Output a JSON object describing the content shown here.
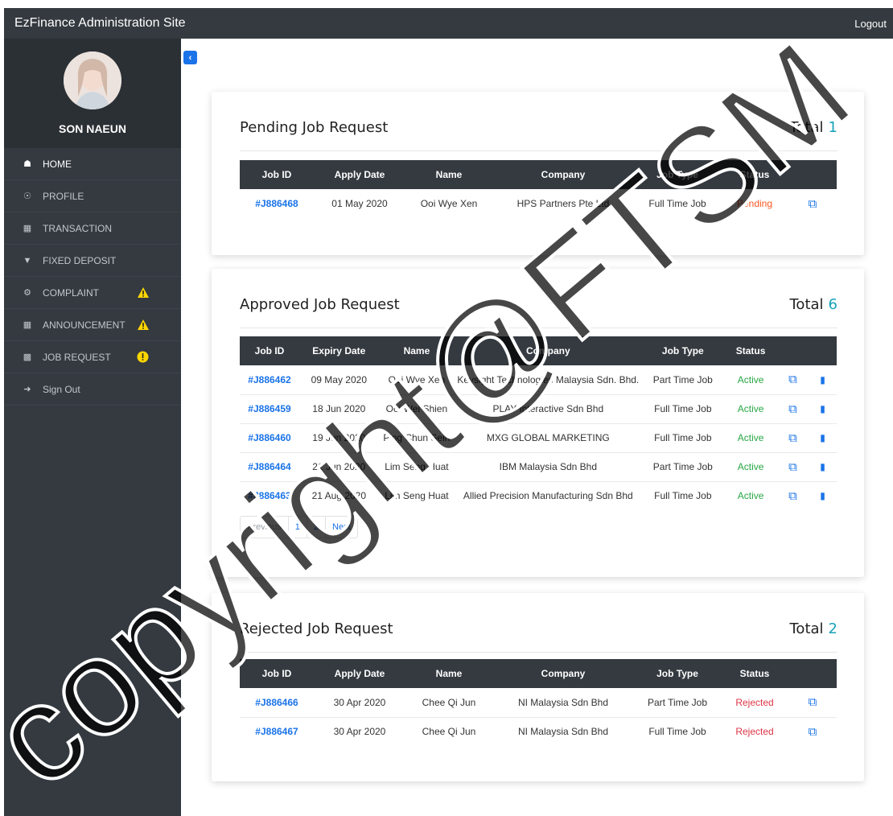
{
  "topbar": {
    "brand": "EzFinance Administration Site",
    "logout": "Logout"
  },
  "sidebar": {
    "username": "SON NAEUN",
    "items": [
      {
        "label": "HOME",
        "icon": "home-icon"
      },
      {
        "label": "PROFILE",
        "icon": "globe-icon"
      },
      {
        "label": "TRANSACTION",
        "icon": "money-icon"
      },
      {
        "label": "FIXED DEPOSIT",
        "icon": "trophy-icon"
      },
      {
        "label": "COMPLAINT",
        "icon": "gear-icon",
        "badge": "warning-icon"
      },
      {
        "label": "ANNOUNCEMENT",
        "icon": "bullhorn-icon",
        "badge": "warning-icon"
      },
      {
        "label": "JOB REQUEST",
        "icon": "briefcase-icon",
        "badge": "alert-icon"
      },
      {
        "label": "Sign Out",
        "icon": "signout-icon"
      }
    ]
  },
  "pending": {
    "title": "Pending Job Request",
    "total_label": "Total",
    "total": "1",
    "headers": [
      "Job ID",
      "Apply Date",
      "Name",
      "Company",
      "Job Type",
      "Status"
    ],
    "rows": [
      {
        "id": "#J886468",
        "date": "01 May 2020",
        "name": "Ooi Wye Xen",
        "company": "HPS Partners Pte Ltd",
        "type": "Full Time Job",
        "status": "Pending"
      }
    ]
  },
  "approved": {
    "title": "Approved Job Request",
    "total_label": "Total",
    "total": "6",
    "headers": [
      "Job ID",
      "Expiry Date",
      "Name",
      "Company",
      "Job Type",
      "Status"
    ],
    "rows": [
      {
        "id": "#J886462",
        "date": "09 May 2020",
        "name": "Ooi Wye Xen",
        "company": "Keysight Technologies Malaysia Sdn. Bhd.",
        "type": "Part Time Job",
        "status": "Active"
      },
      {
        "id": "#J886459",
        "date": "18 Jun 2020",
        "name": "Ooi Wei Shien",
        "company": "PLAY Interactive Sdn Bhd",
        "type": "Full Time Job",
        "status": "Active"
      },
      {
        "id": "#J886460",
        "date": "19 Jun 2020",
        "name": "P'ng Chun Sein",
        "company": "MXG GLOBAL MARKETING",
        "type": "Full Time Job",
        "status": "Active"
      },
      {
        "id": "#J886464",
        "date": "21 Jun 2020",
        "name": "Lim Seng Huat",
        "company": "IBM Malaysia Sdn Bhd",
        "type": "Part Time Job",
        "status": "Active"
      },
      {
        "id": "#J886463",
        "date": "21 Aug 2020",
        "name": "Lim Seng Huat",
        "company": "Allied Precision Manufacturing Sdn Bhd",
        "type": "Full Time Job",
        "status": "Active"
      }
    ],
    "pagination": {
      "previous": "Previous",
      "page1": "1",
      "page2": "2",
      "next": "Next"
    }
  },
  "rejected": {
    "title": "Rejected Job Request",
    "total_label": "Total",
    "total": "2",
    "headers": [
      "Job ID",
      "Apply Date",
      "Name",
      "Company",
      "Job Type",
      "Status"
    ],
    "rows": [
      {
        "id": "#J886466",
        "date": "30 Apr 2020",
        "name": "Chee Qi Jun",
        "company": "NI Malaysia Sdn Bhd",
        "type": "Part Time Job",
        "status": "Rejected"
      },
      {
        "id": "#J886467",
        "date": "30 Apr 2020",
        "name": "Chee Qi Jun",
        "company": "NI Malaysia Sdn Bhd",
        "type": "Full Time Job",
        "status": "Rejected"
      }
    ]
  },
  "watermark": "copyright@FTSM",
  "colors": {
    "accent": "#1a73e8",
    "pending": "#ff5722",
    "active": "#28a745",
    "rejected": "#dc3545",
    "total": "#17a2b8",
    "warning": "#ffd600"
  }
}
